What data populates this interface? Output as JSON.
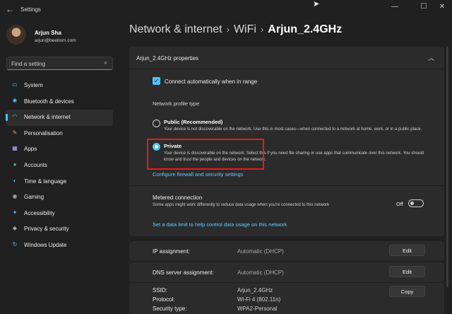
{
  "window": {
    "title": "Settings",
    "back_glyph": "←",
    "minimize_glyph": "—",
    "maximize_glyph": "☐",
    "close_glyph": "✕"
  },
  "user": {
    "name": "Arjun Sha",
    "email": "arjun@beebom.com"
  },
  "search": {
    "placeholder": "Find a setting",
    "icon": "search-icon"
  },
  "sidebar": {
    "items": [
      {
        "label": "System",
        "icon": "monitor-icon",
        "glyph": "▭",
        "color": "#4cc2ff",
        "active": false
      },
      {
        "label": "Bluetooth & devices",
        "icon": "bluetooth-icon",
        "glyph": "✱",
        "color": "#4cc2ff",
        "active": false
      },
      {
        "label": "Network & internet",
        "icon": "wifi-icon",
        "glyph": "◠",
        "color": "#4cc2ff",
        "active": true
      },
      {
        "label": "Personalisation",
        "icon": "brush-icon",
        "glyph": "✎",
        "color": "#f0a33a",
        "active": false
      },
      {
        "label": "Apps",
        "icon": "apps-icon",
        "glyph": "▦",
        "color": "#b8b8ff",
        "active": false
      },
      {
        "label": "Accounts",
        "icon": "person-icon",
        "glyph": "●",
        "color": "#3fc28a",
        "active": false
      },
      {
        "label": "Time & language",
        "icon": "globe-icon",
        "glyph": "◐",
        "color": "#4cc2ff",
        "active": false
      },
      {
        "label": "Gaming",
        "icon": "gamepad-icon",
        "glyph": "◉",
        "color": "#b0b0b0",
        "active": false
      },
      {
        "label": "Accessibility",
        "icon": "accessibility-icon",
        "glyph": "✦",
        "color": "#4cc2ff",
        "active": false
      },
      {
        "label": "Privacy & security",
        "icon": "shield-icon",
        "glyph": "◆",
        "color": "#9aa4b0",
        "active": false
      },
      {
        "label": "Windows Update",
        "icon": "update-icon",
        "glyph": "↻",
        "color": "#4cc2ff",
        "active": false
      }
    ]
  },
  "breadcrumb": {
    "parts": [
      "Network & internet",
      "WiFi",
      "Arjun_2.4GHz"
    ],
    "separator": "›"
  },
  "properties": {
    "title": "Arjun_2.4GHz properties",
    "connect_auto": {
      "label": "Connect automatically when in range",
      "checked": true
    },
    "profile_type_label": "Network profile type",
    "options": [
      {
        "title": "Public (Recommended)",
        "desc": "Your device is not discoverable on the network. Use this in most cases—when connected to a network at home, work, or in a public place.",
        "checked": false
      },
      {
        "title": "Private",
        "desc": "Your device is discoverable on the network. Select this if you need file sharing or use apps that communicate over this network. You should know and trust the people and devices on the network.",
        "checked": true
      }
    ],
    "firewall_link": "Configure firewall and security settings",
    "metered": {
      "title": "Metered connection",
      "desc": "Some apps might work differently to reduce data usage when you're connected to this network",
      "toggle_label": "Off"
    },
    "data_limit_link": "Set a data limit to help control data usage on this network"
  },
  "rows": {
    "ip": {
      "label": "IP assignment:",
      "value": "Automatic (DHCP)",
      "button": "Edit"
    },
    "dns": {
      "label": "DNS server assignment:",
      "value": "Automatic (DHCP)",
      "button": "Edit"
    },
    "info": {
      "labels": [
        "SSID:",
        "Protocol:",
        "Security type:"
      ],
      "values": [
        "Arjun_2.4GHz",
        "Wi-Fi 4 (802.11n)",
        "WPA2-Personal"
      ],
      "button": "Copy"
    }
  },
  "colors": {
    "accent": "#4cc2ff",
    "link": "#60cdff",
    "highlight": "#e41b1b",
    "background": "#202020",
    "card": "#2b2b2b"
  }
}
